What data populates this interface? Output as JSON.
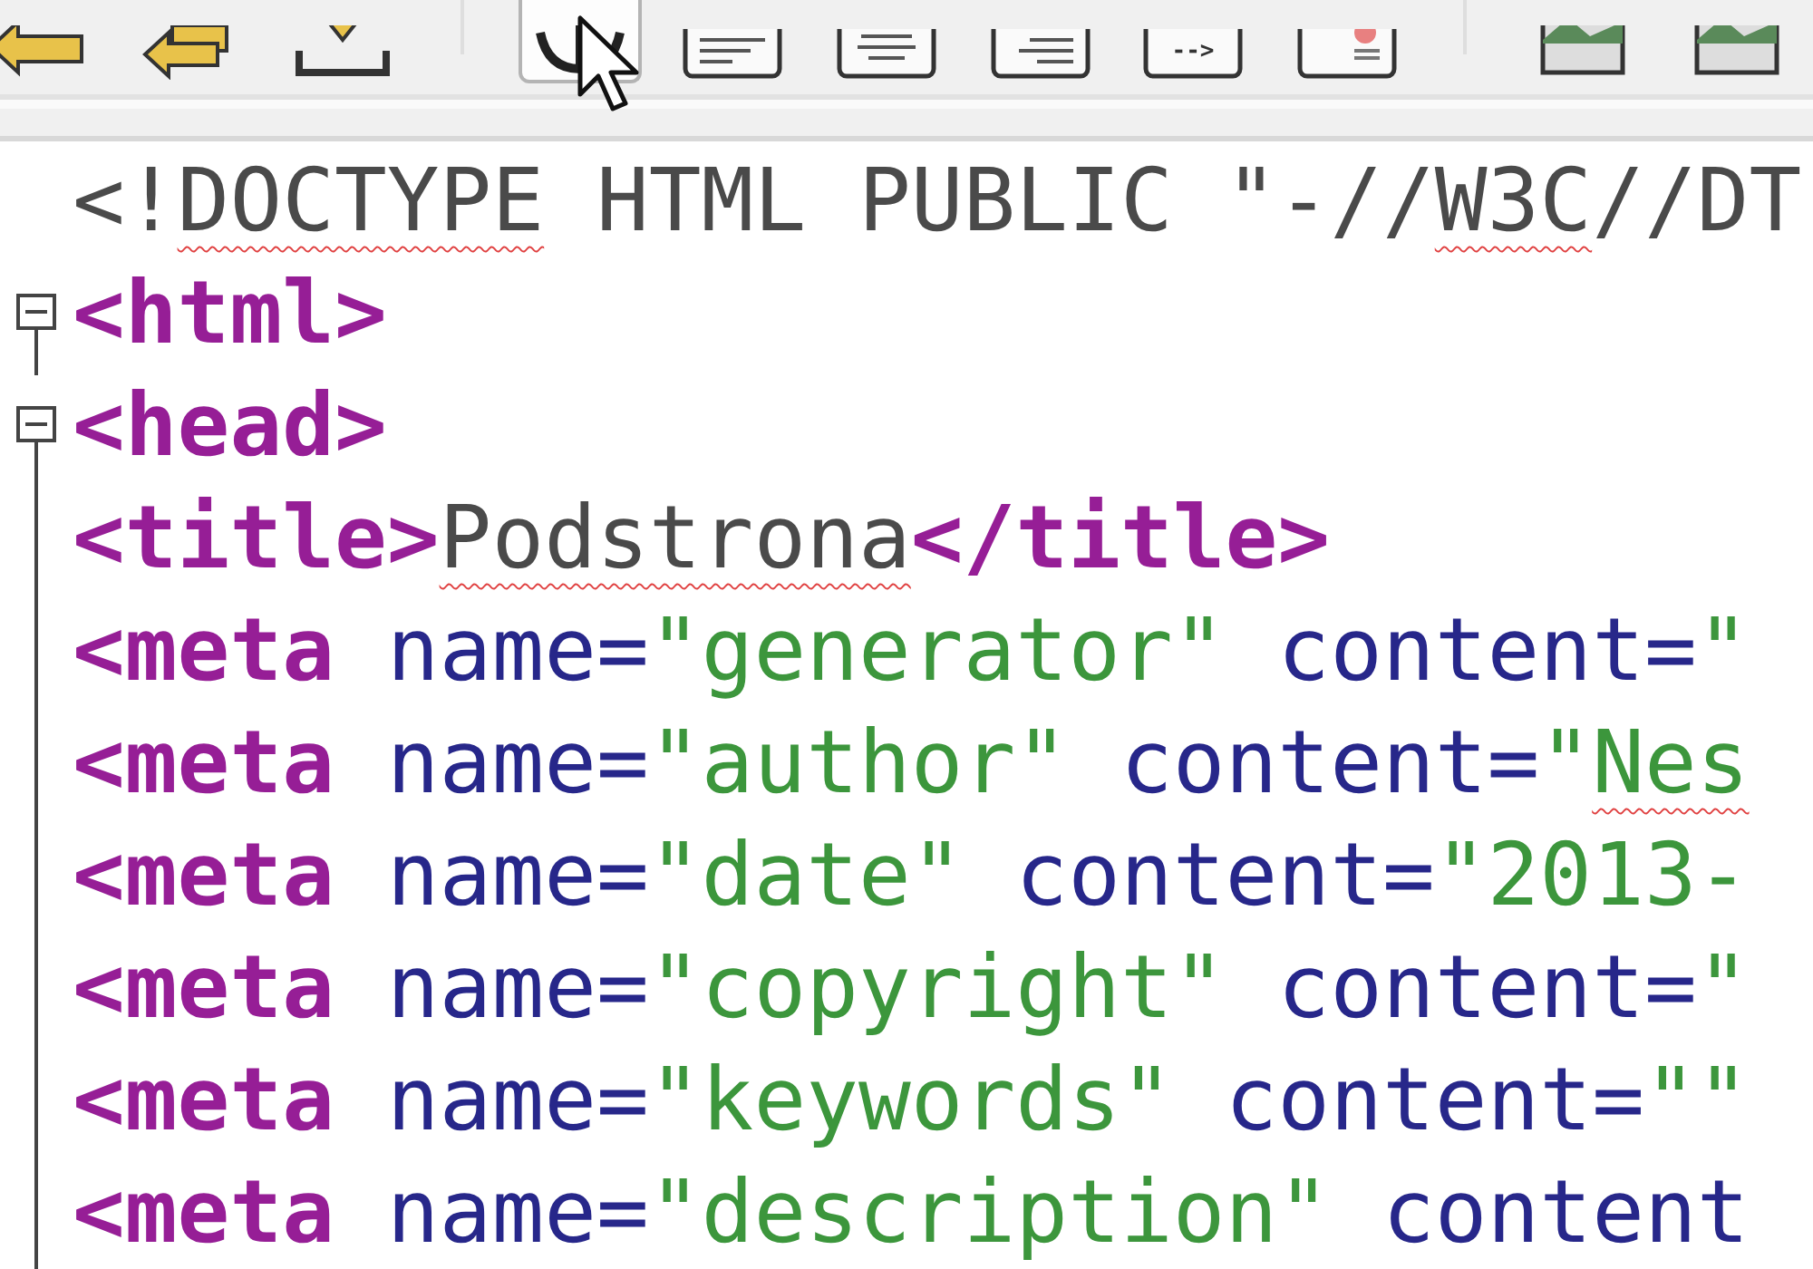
{
  "toolbar": [
    {
      "kind": "undo",
      "selected": false
    },
    {
      "kind": "redo",
      "selected": false
    },
    {
      "kind": "download",
      "selected": false
    },
    {
      "kind": "separator"
    },
    {
      "kind": "anchor",
      "selected": true
    },
    {
      "kind": "align-left",
      "selected": false
    },
    {
      "kind": "align-center",
      "selected": false
    },
    {
      "kind": "align-right",
      "selected": false
    },
    {
      "kind": "comment",
      "label": "-->",
      "selected": false
    },
    {
      "kind": "image-doc",
      "selected": false
    },
    {
      "kind": "separator"
    },
    {
      "kind": "image",
      "selected": false
    },
    {
      "kind": "image",
      "selected": false
    }
  ],
  "editor": {
    "lines": [
      {
        "kind": "header",
        "tokens": [
          {
            "kind": "plain",
            "text": "<!"
          },
          {
            "kind": "plain",
            "text": "DOCTYPE",
            "misspelled": true
          },
          {
            "kind": "plain",
            "text": " HTML PUBLIC \"-//"
          },
          {
            "kind": "plain",
            "text": "W3C",
            "misspelled": true
          },
          {
            "kind": "plain",
            "text": "//DT"
          }
        ]
      },
      {
        "kind": "fold",
        "tokens": [
          {
            "kind": "tag",
            "text": "<html>"
          }
        ]
      },
      {
        "kind": "fold",
        "tokens": [
          {
            "kind": "tag",
            "text": "<head>"
          }
        ]
      },
      {
        "kind": "body",
        "tokens": [
          {
            "kind": "tag",
            "text": "<title>"
          },
          {
            "kind": "plain",
            "text": "Podstrona",
            "misspelled": true
          },
          {
            "kind": "tag",
            "text": "</title>"
          }
        ]
      },
      {
        "kind": "body",
        "tokens": [
          {
            "kind": "tag",
            "text": "<meta"
          },
          {
            "kind": "attr",
            "text": " name="
          },
          {
            "kind": "value",
            "text": "\"generator\""
          },
          {
            "kind": "attr",
            "text": " content="
          },
          {
            "kind": "value",
            "text": "\""
          }
        ]
      },
      {
        "kind": "body",
        "tokens": [
          {
            "kind": "tag",
            "text": "<meta"
          },
          {
            "kind": "attr",
            "text": " name="
          },
          {
            "kind": "value",
            "text": "\"author\""
          },
          {
            "kind": "attr",
            "text": " content="
          },
          {
            "kind": "value",
            "text": "\""
          },
          {
            "kind": "value",
            "text": "Nes",
            "misspelled": true
          }
        ]
      },
      {
        "kind": "body",
        "tokens": [
          {
            "kind": "tag",
            "text": "<meta"
          },
          {
            "kind": "attr",
            "text": " name="
          },
          {
            "kind": "value",
            "text": "\"date\""
          },
          {
            "kind": "attr",
            "text": " content="
          },
          {
            "kind": "value",
            "text": "\"2013-"
          }
        ]
      },
      {
        "kind": "body",
        "tokens": [
          {
            "kind": "tag",
            "text": "<meta"
          },
          {
            "kind": "attr",
            "text": " name="
          },
          {
            "kind": "value",
            "text": "\"copyright\""
          },
          {
            "kind": "attr",
            "text": " content="
          },
          {
            "kind": "value",
            "text": "\""
          }
        ]
      },
      {
        "kind": "body",
        "tokens": [
          {
            "kind": "tag",
            "text": "<meta"
          },
          {
            "kind": "attr",
            "text": " name="
          },
          {
            "kind": "value",
            "text": "\"keywords\""
          },
          {
            "kind": "attr",
            "text": " content="
          },
          {
            "kind": "value",
            "text": "\"\""
          }
        ]
      },
      {
        "kind": "body",
        "tokens": [
          {
            "kind": "tag",
            "text": "<meta"
          },
          {
            "kind": "attr",
            "text": " name="
          },
          {
            "kind": "value",
            "text": "\"description\""
          },
          {
            "kind": "attr",
            "text": " content"
          }
        ]
      }
    ]
  }
}
